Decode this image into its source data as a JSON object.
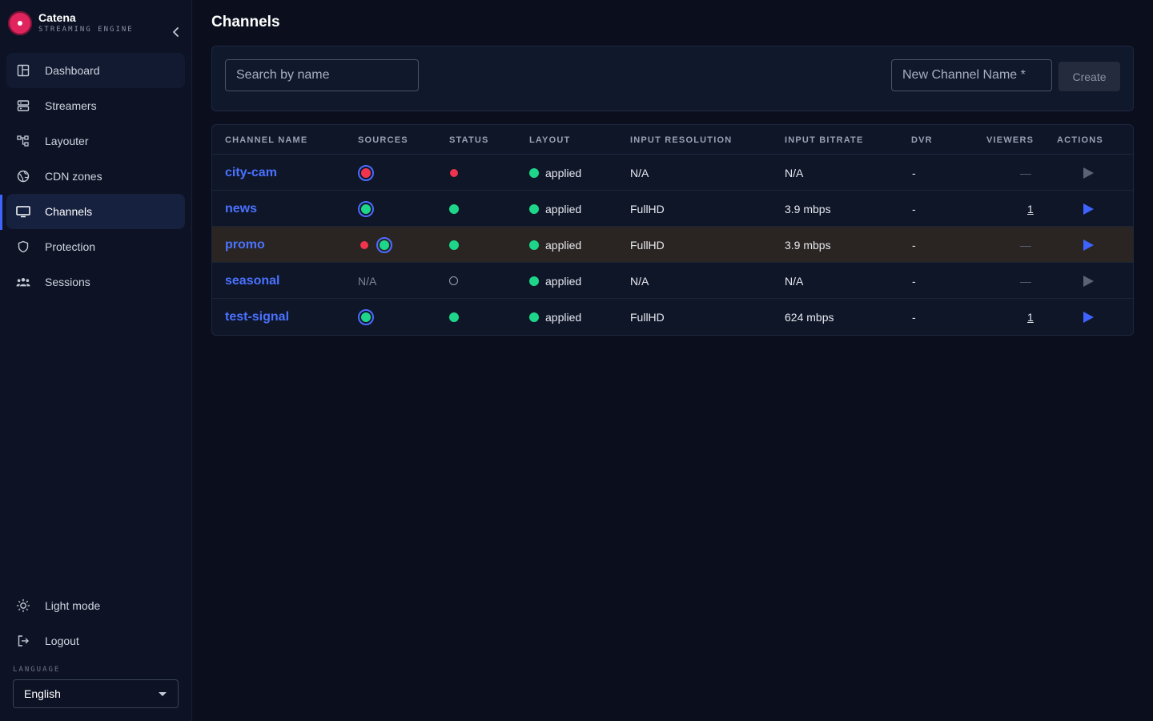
{
  "app": {
    "name": "Catena",
    "subtitle": "STREAMING ENGINE"
  },
  "sidebar": {
    "items": [
      {
        "label": "Dashboard",
        "icon": "dashboard-icon"
      },
      {
        "label": "Streamers",
        "icon": "server-icon"
      },
      {
        "label": "Layouter",
        "icon": "layout-tree-icon"
      },
      {
        "label": "CDN zones",
        "icon": "globe-icon"
      },
      {
        "label": "Channels",
        "icon": "monitor-icon",
        "active": true
      },
      {
        "label": "Protection",
        "icon": "shield-icon"
      },
      {
        "label": "Sessions",
        "icon": "users-icon"
      }
    ],
    "bottom": [
      {
        "label": "Light mode",
        "icon": "sun-icon"
      },
      {
        "label": "Logout",
        "icon": "logout-icon"
      }
    ],
    "language_label": "LANGUAGE",
    "language_value": "English"
  },
  "page": {
    "title": "Channels"
  },
  "toolbar": {
    "search_placeholder": "Search by name",
    "new_name_placeholder": "New Channel Name *",
    "create_label": "Create"
  },
  "table": {
    "headers": [
      "CHANNEL NAME",
      "SOURCES",
      "STATUS",
      "LAYOUT",
      "INPUT RESOLUTION",
      "INPUT BITRATE",
      "DVR",
      "VIEWERS",
      "ACTIONS"
    ],
    "rows": [
      {
        "name": "city-cam",
        "sources": "red-ring",
        "status": "red",
        "layout": "applied",
        "resolution": "N/A",
        "bitrate": "N/A",
        "dvr": "-",
        "viewers": "—",
        "play_active": false,
        "highlight": false
      },
      {
        "name": "news",
        "sources": "green-ring",
        "status": "green",
        "layout": "applied",
        "resolution": "FullHD",
        "bitrate": "3.9 mbps",
        "dvr": "-",
        "viewers": "1",
        "play_active": true,
        "highlight": false
      },
      {
        "name": "promo",
        "sources": "red-dot-green-ring",
        "status": "green",
        "layout": "applied",
        "resolution": "FullHD",
        "bitrate": "3.9 mbps",
        "dvr": "-",
        "viewers": "—",
        "play_active": true,
        "highlight": true
      },
      {
        "name": "seasonal",
        "sources": "N/A",
        "status": "hollow",
        "layout": "applied",
        "resolution": "N/A",
        "bitrate": "N/A",
        "dvr": "-",
        "viewers": "—",
        "play_active": false,
        "highlight": false
      },
      {
        "name": "test-signal",
        "sources": "green-ring",
        "status": "green",
        "layout": "applied",
        "resolution": "FullHD",
        "bitrate": "624 mbps",
        "dvr": "-",
        "viewers": "1",
        "play_active": true,
        "highlight": false
      }
    ]
  },
  "colors": {
    "accent": "#3e63ff",
    "green": "#1ed68a",
    "red": "#f0344e",
    "brand": "#e0245e"
  }
}
